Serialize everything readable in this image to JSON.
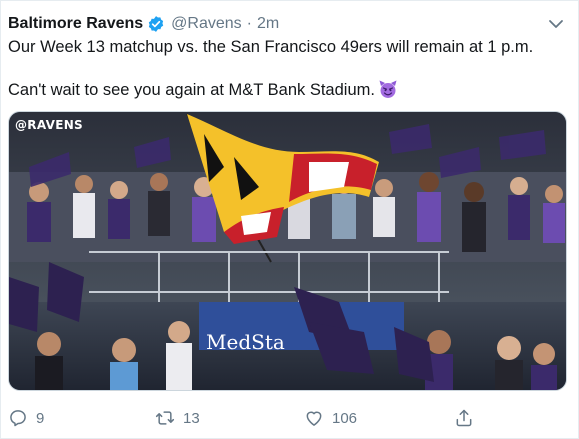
{
  "tweet": {
    "author_name": "Baltimore Ravens",
    "handle": "@Ravens",
    "separator": "·",
    "time": "2m",
    "text_line1": "Our Week 13 matchup vs. the San Francisco 49ers will remain at 1 p.m.",
    "text_line2": "Can't wait to see you again at M&T Bank Stadium.",
    "emoji": "smiling-face-with-horns",
    "media": {
      "watermark": "@RAVENS",
      "banner_text": "MedSta"
    },
    "actions": {
      "replies": "9",
      "retweets": "13",
      "likes": "106"
    }
  },
  "colors": {
    "verified_blue": "#1da1f2",
    "secondary_text": "#657786",
    "ravens_purple": "#3b2a6b"
  }
}
